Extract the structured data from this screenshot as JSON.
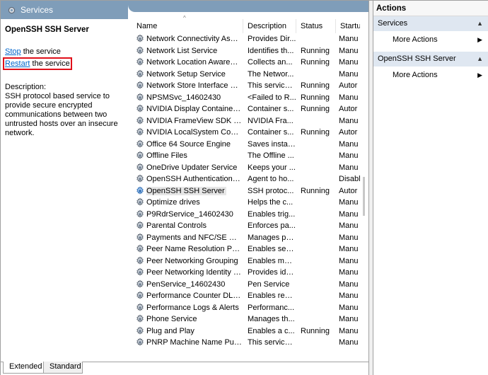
{
  "window": {
    "tab_title": "Services",
    "colors": {
      "header_blue": "#7f9db9",
      "selection": "#e6e6e6",
      "link": "#0066cc",
      "highlight_box": "#e0101a",
      "actions_section": "#dfe7f1"
    }
  },
  "detail": {
    "service_name": "OpenSSH SSH Server",
    "stop_link": "Stop",
    "stop_rest": " the service",
    "restart_link": "Restart",
    "restart_rest": " the service",
    "description_label": "Description:",
    "description_text": "SSH protocol based service to provide secure encrypted communications between two untrusted hosts over an insecure network."
  },
  "columns": {
    "name": "Name",
    "description": "Description",
    "status": "Status",
    "startup": "Startu"
  },
  "rows": [
    {
      "name": "Network Connectivity Assis...",
      "desc": "Provides Dir...",
      "status": "",
      "startup": "Manu"
    },
    {
      "name": "Network List Service",
      "desc": "Identifies th...",
      "status": "Running",
      "startup": "Manu"
    },
    {
      "name": "Network Location Awareness",
      "desc": "Collects an...",
      "status": "Running",
      "startup": "Manu"
    },
    {
      "name": "Network Setup Service",
      "desc": "The Networ...",
      "status": "",
      "startup": "Manu"
    },
    {
      "name": "Network Store Interface Ser...",
      "desc": "This service ...",
      "status": "Running",
      "startup": "Autor"
    },
    {
      "name": "NPSMSvc_14602430",
      "desc": "<Failed to R...",
      "status": "Running",
      "startup": "Manu"
    },
    {
      "name": "NVIDIA Display Container LS",
      "desc": "Container s...",
      "status": "Running",
      "startup": "Autor"
    },
    {
      "name": "NVIDIA FrameView SDK serv...",
      "desc": "NVIDIA Fra...",
      "status": "",
      "startup": "Manu"
    },
    {
      "name": "NVIDIA LocalSystem Contai...",
      "desc": "Container s...",
      "status": "Running",
      "startup": "Autor"
    },
    {
      "name": "Office 64 Source Engine",
      "desc": "Saves install...",
      "status": "",
      "startup": "Manu"
    },
    {
      "name": "Offline Files",
      "desc": "The Offline ...",
      "status": "",
      "startup": "Manu"
    },
    {
      "name": "OneDrive Updater Service",
      "desc": "Keeps your ...",
      "status": "",
      "startup": "Manu"
    },
    {
      "name": "OpenSSH Authentication A...",
      "desc": "Agent to ho...",
      "status": "",
      "startup": "Disabl"
    },
    {
      "name": "OpenSSH SSH Server",
      "desc": "SSH protoc...",
      "status": "Running",
      "startup": "Autor"
    },
    {
      "name": "Optimize drives",
      "desc": "Helps the c...",
      "status": "",
      "startup": "Manu"
    },
    {
      "name": "P9RdrService_14602430",
      "desc": "Enables trig...",
      "status": "",
      "startup": "Manu"
    },
    {
      "name": "Parental Controls",
      "desc": "Enforces pa...",
      "status": "",
      "startup": "Manu"
    },
    {
      "name": "Payments and NFC/SE Man...",
      "desc": "Manages pa...",
      "status": "",
      "startup": "Manu"
    },
    {
      "name": "Peer Name Resolution Prot...",
      "desc": "Enables serv...",
      "status": "",
      "startup": "Manu"
    },
    {
      "name": "Peer Networking Grouping",
      "desc": "Enables mul...",
      "status": "",
      "startup": "Manu"
    },
    {
      "name": "Peer Networking Identity M...",
      "desc": "Provides ide...",
      "status": "",
      "startup": "Manu"
    },
    {
      "name": "PenService_14602430",
      "desc": "Pen Service",
      "status": "",
      "startup": "Manu"
    },
    {
      "name": "Performance Counter DLL ...",
      "desc": "Enables rem...",
      "status": "",
      "startup": "Manu"
    },
    {
      "name": "Performance Logs & Alerts",
      "desc": "Performanc...",
      "status": "",
      "startup": "Manu"
    },
    {
      "name": "Phone Service",
      "desc": "Manages th...",
      "status": "",
      "startup": "Manu"
    },
    {
      "name": "Plug and Play",
      "desc": "Enables a c...",
      "status": "Running",
      "startup": "Manu"
    },
    {
      "name": "PNRP Machine Name Publi...",
      "desc": "This service ...",
      "status": "",
      "startup": "Manu"
    }
  ],
  "selected_row_index": 13,
  "bottom_tabs": {
    "extended": "Extended",
    "standard": "Standard"
  },
  "actions": {
    "header": "Actions",
    "section1": "Services",
    "section1_item": "More Actions",
    "section2": "OpenSSH SSH Server",
    "section2_item": "More Actions"
  }
}
